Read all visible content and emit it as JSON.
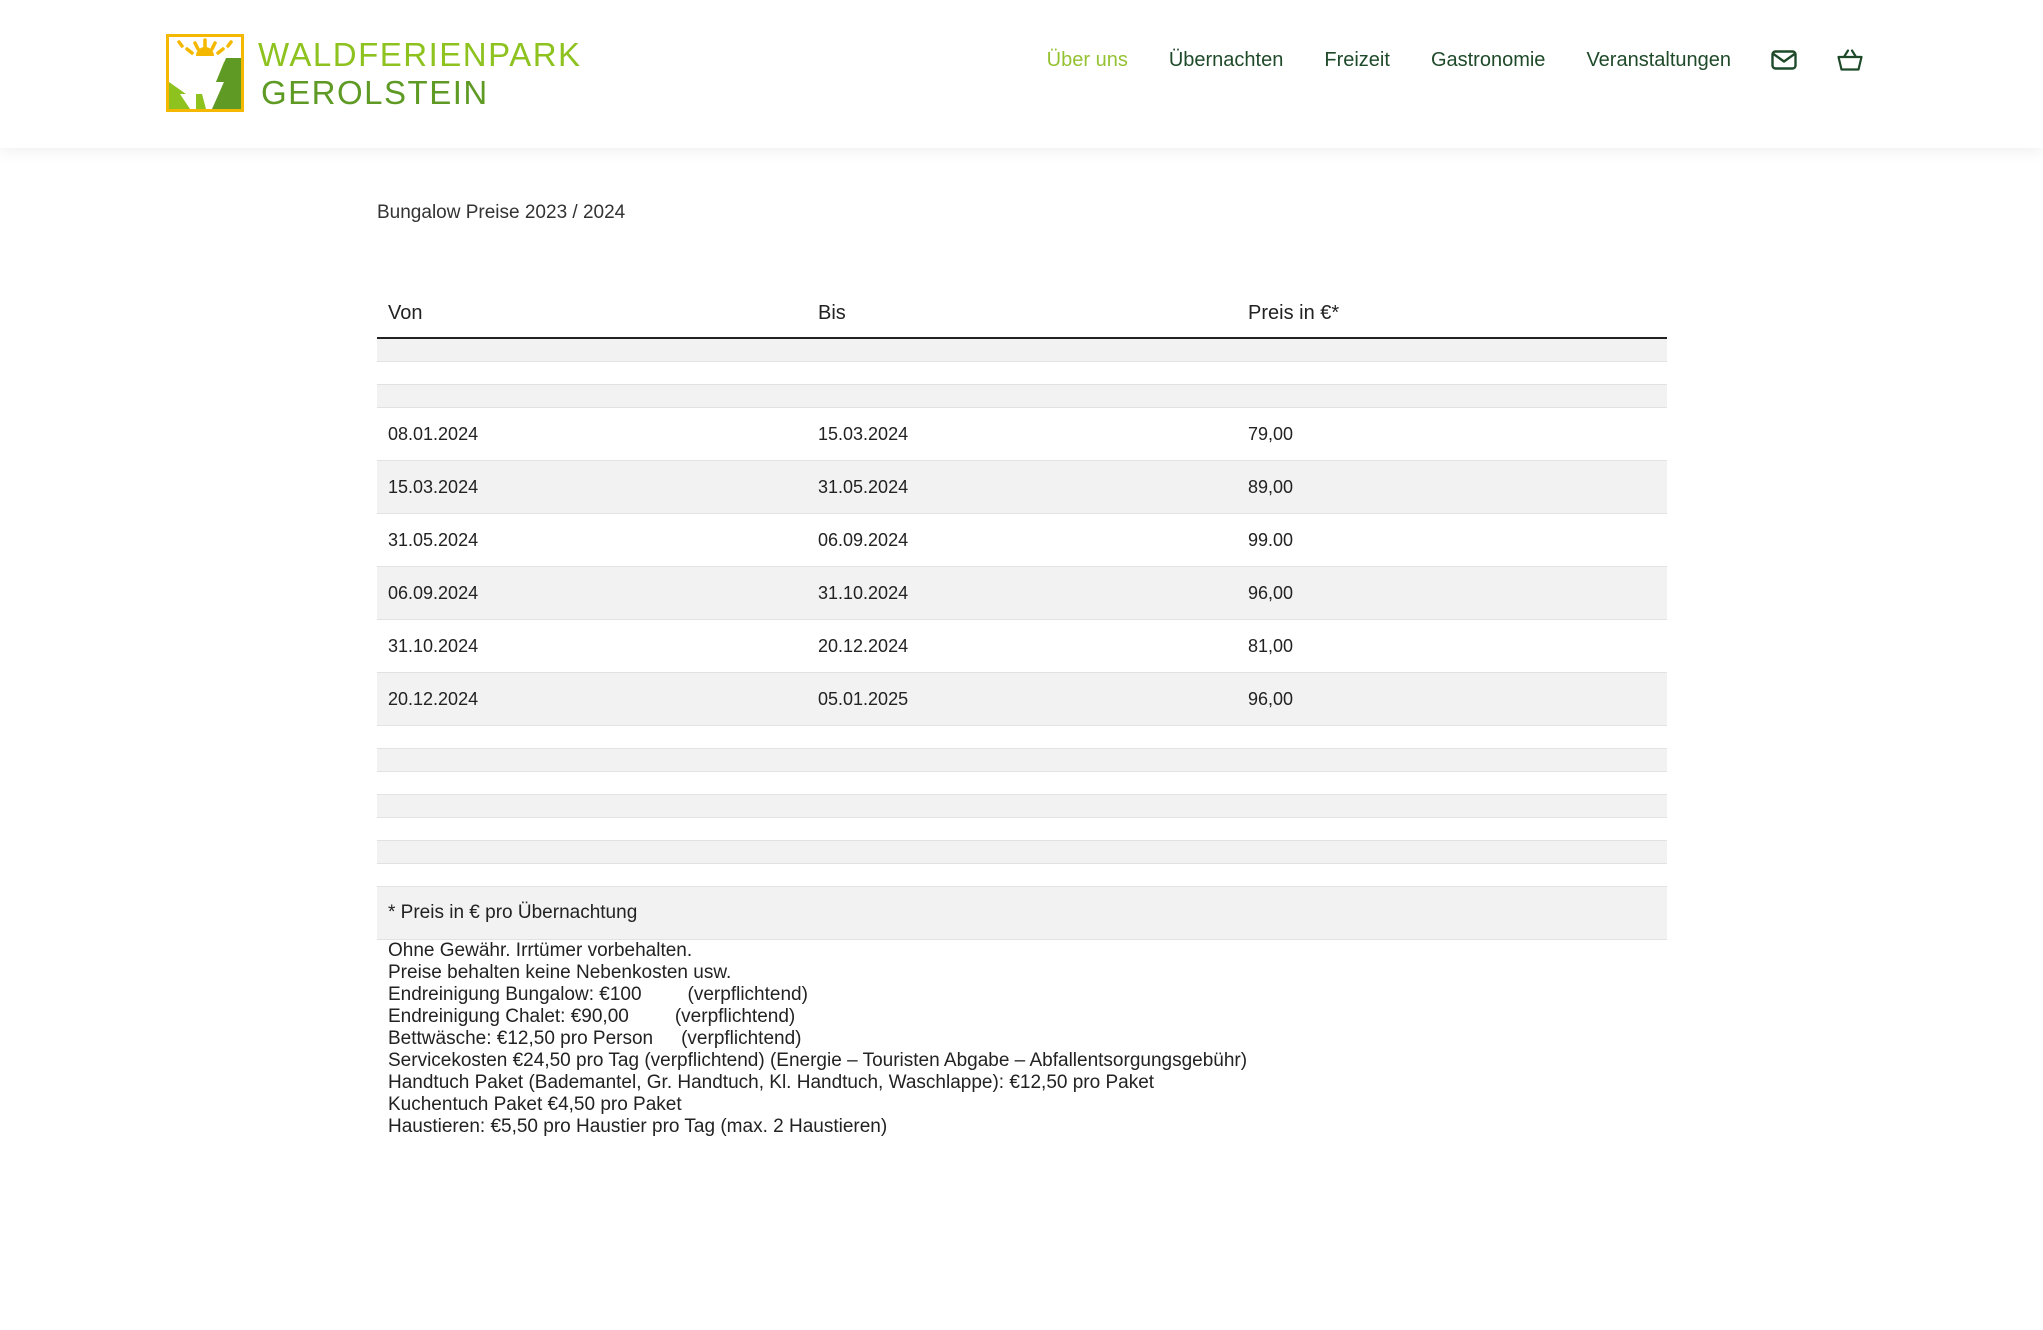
{
  "brand": {
    "name_line1": "WALDFERIENPARK",
    "name_line2": "GEROLSTEIN",
    "logo_icon": "forest-sun-logo-icon",
    "colors": {
      "light_green": "#8dc21f",
      "dark_green": "#5e9a24",
      "sun_yellow": "#f5b800",
      "nav_text": "#1f4a2a",
      "nav_active": "#95c233"
    }
  },
  "nav": {
    "items": [
      {
        "label": "Über uns",
        "active": true
      },
      {
        "label": "Übernachten",
        "active": false
      },
      {
        "label": "Freizeit",
        "active": false
      },
      {
        "label": "Gastronomie",
        "active": false
      },
      {
        "label": "Veranstaltungen",
        "active": false
      }
    ],
    "icons": [
      "mail-icon",
      "basket-icon"
    ]
  },
  "page": {
    "title": "Bungalow Preise 2023 / 2024"
  },
  "table": {
    "headers": {
      "von": "Von",
      "bis": "Bis",
      "preis": "Preis in €*"
    },
    "rows": [
      {
        "von": "08.01.2024",
        "bis": "15.03.2024",
        "preis": "79,00"
      },
      {
        "von": "15.03.2024",
        "bis": "31.05.2024",
        "preis": "89,00"
      },
      {
        "von": "31.05.2024",
        "bis": "06.09.2024",
        "preis": "99.00"
      },
      {
        "von": "06.09.2024",
        "bis": "31.10.2024",
        "preis": "96,00"
      },
      {
        "von": "31.10.2024",
        "bis": "20.12.2024",
        "preis": "81,00"
      },
      {
        "von": "20.12.2024",
        "bis": "05.01.2025",
        "preis": "96,00"
      }
    ],
    "footnote": "* Preis in € pro Übernachtung"
  },
  "notes": {
    "disclaimer": "Ohne Gewähr. Irrtümer vorbehalten.",
    "no_extras": "Preise behalten keine Nebenkosten usw.",
    "cleaning_bungalow": "Endreinigung Bungalow: €100",
    "cleaning_bungalow_status": "(verpflichtend)",
    "cleaning_chalet": "Endreinigung Chalet: €90,00",
    "cleaning_chalet_status": "(verpflichtend)",
    "bedding": "Bettwäsche: €12,50 pro Person",
    "bedding_status": "(verpflichtend)",
    "service": "Servicekosten €24,50 pro Tag (verpflichtend) (Energie – Touristen Abgabe – Abfallentsorgungsgebühr)",
    "towel_pack": "Handtuch Paket (Bademantel, Gr. Handtuch, Kl. Handtuch, Waschlappe): €12,50 pro Paket",
    "kitchen_towel": "Kuchentuch Paket €4,50 pro Paket",
    "pets": "Haustieren: €5,50 pro Haustier pro Tag (max. 2 Haustieren)"
  }
}
